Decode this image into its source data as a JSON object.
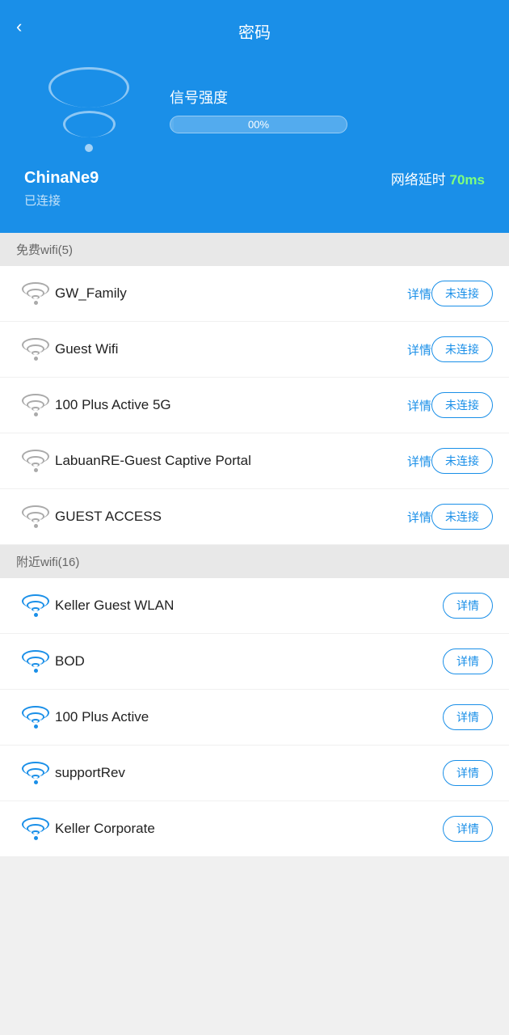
{
  "header": {
    "title": "密码",
    "back_label": "‹",
    "signal_label": "信号强度",
    "signal_percent": "00%",
    "latency_label": "网络延时",
    "latency_value": "70ms",
    "connected_ssid": "ChinaNe9",
    "connected_status": "已连接"
  },
  "free_wifi_section": {
    "label": "免费wifi(5)",
    "items": [
      {
        "ssid": "GW_Family",
        "detail": "详情",
        "action": "未连接"
      },
      {
        "ssid": "Guest Wifi",
        "detail": "详情",
        "action": "未连接"
      },
      {
        "ssid": "100 Plus Active 5G",
        "detail": "详情",
        "action": "未连接"
      },
      {
        "ssid": "LabuanRE-Guest Captive Portal",
        "detail": "详情",
        "action": "未连接"
      },
      {
        "ssid": "GUEST ACCESS",
        "detail": "详情",
        "action": "未连接"
      }
    ]
  },
  "nearby_wifi_section": {
    "label": "附近wifi(16)",
    "items": [
      {
        "ssid": "Keller Guest WLAN",
        "detail": "详情"
      },
      {
        "ssid": "BOD",
        "detail": "详情"
      },
      {
        "ssid": "100 Plus Active",
        "detail": "详情"
      },
      {
        "ssid": "supportRev",
        "detail": "详情"
      },
      {
        "ssid": "Keller Corporate",
        "detail": "详情"
      }
    ]
  }
}
